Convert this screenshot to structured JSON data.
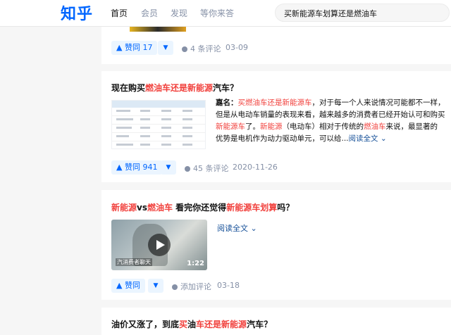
{
  "header": {
    "logo": "知乎",
    "nav": [
      "首页",
      "会员",
      "发现",
      "等你来答"
    ],
    "search_value": "买新能源车划算还是燃油车"
  },
  "cards": [
    {
      "vote_label": "▲ 赞同 17",
      "comments": "4 条评论",
      "date": "03-09"
    },
    {
      "title_parts": [
        "现在购买",
        "燃油车还是新能源",
        "汽车？"
      ],
      "excerpt_lines": [
        [
          "嘉名：",
          "买燃油车还是新能源车",
          "，对于每一个人来说情况可能都不一样，"
        ],
        [
          "但是从电动车销量的表现来看，越来越多的消费者已经开始认可和购买"
        ],
        [
          "新能源车",
          "了。",
          "新能源",
          "（电动车）相对于传统的",
          "燃油车",
          "来说，最显著的"
        ],
        [
          "优势是电机作为动力驱动单元，可以给...",
          "阅读全文 ⌄"
        ]
      ],
      "vote_label": "▲ 赞同 941",
      "comments": "45 条评论",
      "date": "2020-11-26"
    },
    {
      "title_parts": [
        "新能源",
        "vs",
        "燃油车",
        " 看完你还觉得",
        "新能源车划算",
        "吗？"
      ],
      "readmore": "阅读全文 ⌄",
      "video_duration": "1:22",
      "video_caption": "汽消费者聊天",
      "vote_label": "▲ 赞同",
      "comments": "添加评论",
      "date": "03-18"
    },
    {
      "title_parts": [
        "油价又涨了，到底",
        "买",
        "油",
        "车还是新能源",
        "汽车？"
      ]
    }
  ],
  "colors": {
    "brand": "#0066ff",
    "highlight": "#f1403c",
    "meta": "#8590a6"
  }
}
